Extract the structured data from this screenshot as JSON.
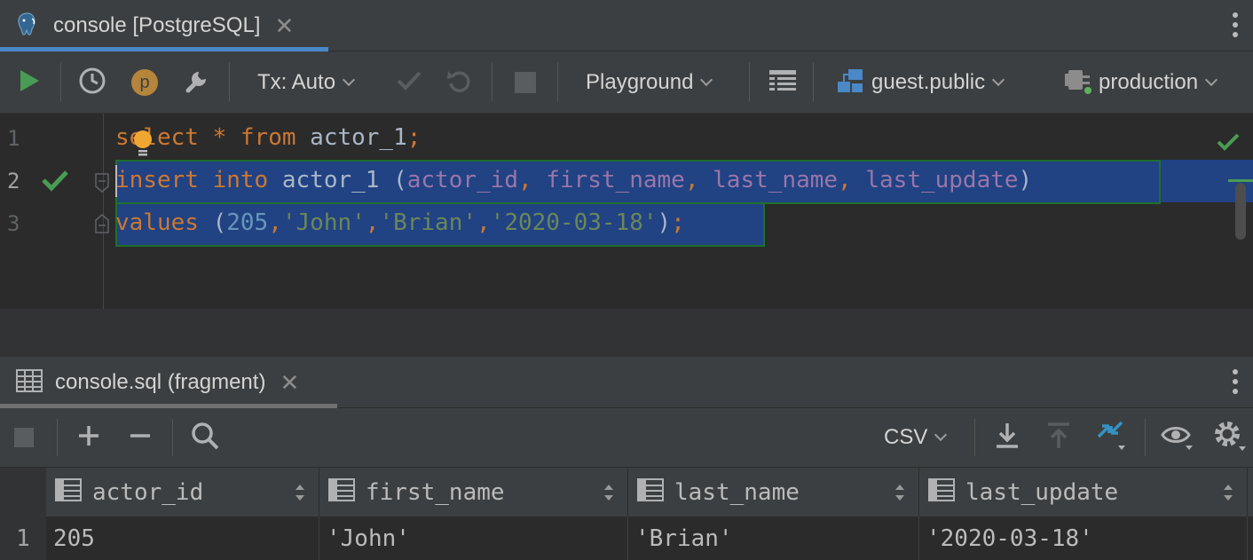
{
  "top_tab": {
    "title": "console [PostgreSQL]",
    "close_glyph": "✕",
    "icon": "postgresql-elephant-icon"
  },
  "toolbar": {
    "run_icon": "play-icon",
    "history_icon": "clock-icon",
    "profile_badge": "p",
    "settings_icon": "wrench-icon",
    "tx_label": "Tx: Auto",
    "commit_icon": "checkmark-icon",
    "rollback_icon": "undo-icon",
    "stop_icon": "stop-icon",
    "mode_label": "Playground",
    "output_icon": "table-output-icon",
    "schema_label": "guest.public",
    "datasource_label": "production"
  },
  "editor": {
    "lines": [
      {
        "number": "1",
        "status": "",
        "tokens": [
          {
            "t": "select",
            "c": "kw"
          },
          {
            "t": " ",
            "c": ""
          },
          {
            "t": "*",
            "c": "kw"
          },
          {
            "t": " ",
            "c": ""
          },
          {
            "t": "from",
            "c": "kw"
          },
          {
            "t": " actor_1",
            "c": ""
          },
          {
            "t": ";",
            "c": "kw"
          }
        ]
      },
      {
        "number": "2",
        "status": "ok",
        "tokens": [
          {
            "t": "insert",
            "c": "kw"
          },
          {
            "t": " ",
            "c": ""
          },
          {
            "t": "into",
            "c": "kw"
          },
          {
            "t": " actor_1 (",
            "c": ""
          },
          {
            "t": "actor_id",
            "c": "col"
          },
          {
            "t": ", ",
            "c": "kw"
          },
          {
            "t": "first_name",
            "c": "col"
          },
          {
            "t": ", ",
            "c": "kw"
          },
          {
            "t": "last_name",
            "c": "col"
          },
          {
            "t": ", ",
            "c": "kw"
          },
          {
            "t": "last_update",
            "c": "col"
          },
          {
            "t": ")",
            "c": ""
          }
        ]
      },
      {
        "number": "3",
        "status": "",
        "tokens": [
          {
            "t": "values",
            "c": "kw"
          },
          {
            "t": " (",
            "c": ""
          },
          {
            "t": "205",
            "c": "num"
          },
          {
            "t": ",",
            "c": "kw"
          },
          {
            "t": "'John'",
            "c": "str"
          },
          {
            "t": ",",
            "c": "kw"
          },
          {
            "t": "'Brian'",
            "c": "str"
          },
          {
            "t": ",",
            "c": "kw"
          },
          {
            "t": "'2020-03-18'",
            "c": "str"
          },
          {
            "t": ")",
            "c": ""
          },
          {
            "t": ";",
            "c": "kw"
          }
        ]
      }
    ]
  },
  "results_tab": {
    "title": "console.sql (fragment)",
    "close_glyph": "✕"
  },
  "results_toolbar": {
    "format_label": "CSV"
  },
  "grid": {
    "columns": [
      "actor_id",
      "first_name",
      "last_name",
      "last_update"
    ],
    "rows": [
      {
        "row_number": "1",
        "cells": [
          "205",
          "'John'",
          "'Brian'",
          "'2020-03-18'"
        ]
      }
    ]
  },
  "colors": {
    "accent": "#4a88c7",
    "run": "#499c54",
    "keyword": "#cc7832",
    "column": "#9876aa",
    "number": "#6897bb",
    "string": "#6a8759",
    "selection": "#214283"
  }
}
